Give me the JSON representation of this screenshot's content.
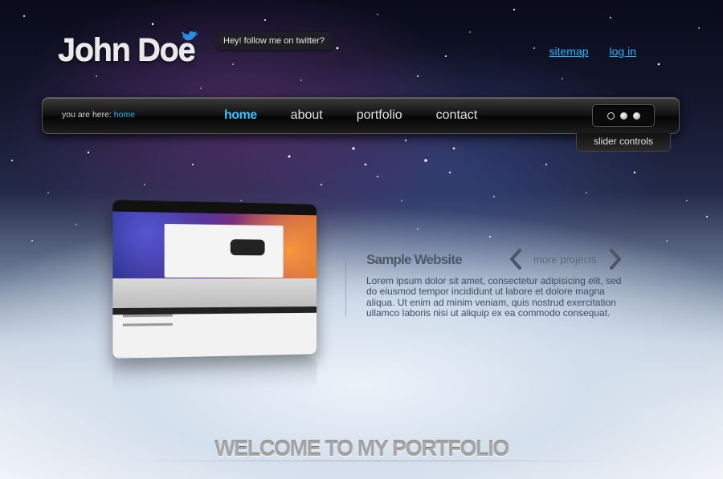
{
  "header": {
    "logo_text": "John Doe",
    "twitter_bubble": "Hey! follow me on twitter?",
    "links": [
      {
        "label": "sitemap"
      },
      {
        "label": "log in"
      }
    ]
  },
  "nav": {
    "breadcrumb_prefix": "you are here:",
    "breadcrumb_current": "home",
    "items": [
      {
        "label": "home",
        "active": true
      },
      {
        "label": "about",
        "active": false
      },
      {
        "label": "portfolio",
        "active": false
      },
      {
        "label": "contact",
        "active": false
      }
    ],
    "slider_tab_label": "slider controls",
    "slider_dots": [
      {
        "state": "active"
      },
      {
        "state": "inactive"
      },
      {
        "state": "inactive"
      }
    ]
  },
  "showcase": {
    "project_title": "Sample Website",
    "more_projects": "more projects",
    "description": "Lorem ipsum dolor sit amet, consectetur adipisicing elit, sed do eiusmod tempor incididunt ut labore et dolore magna aliqua. Ut enim ad minim veniam, quis nostrud exercitation ullamco laboris nisi ut aliquip ex ea commodo consequat."
  },
  "footer": {
    "welcome_heading": "WELCOME TO MY PORTFOLIO"
  },
  "colors": {
    "accent": "#29b6f6",
    "nav_active": "#36c2ff",
    "navbar_bg": "#141414"
  },
  "icons": {
    "logo_mark": "twitter-bird-icon",
    "prev": "chevron-left-icon",
    "next": "chevron-right-icon"
  }
}
